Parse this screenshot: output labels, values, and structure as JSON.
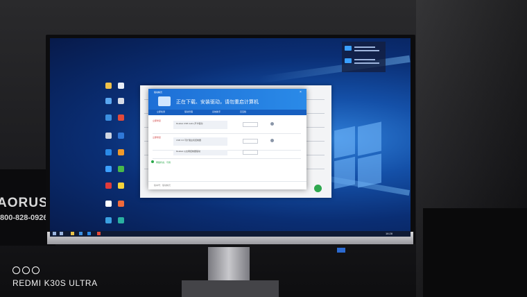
{
  "photo": {
    "watermark": "REDMI K30S ULTRA",
    "background_brand": "AORUS",
    "background_phone": "800-828-0926"
  },
  "desktop": {
    "wallpaper_color": "#1450a8",
    "installer": {
      "app_name": "驱动精灵",
      "title": "正在下载、安装驱动，请勿重启计算机",
      "tabs": [
        "立即检测",
        "驱动管理",
        "系统助手",
        "百宝箱"
      ],
      "rows": [
        {
          "label": "立即修复",
          "text": "Realtek USB Audio 声卡驱动"
        },
        {
          "label": "立即修复",
          "text": "USB 3.0 可扩展主机控制器"
        },
        {
          "label": "",
          "text": "Realtek 以太网控制器驱动"
        }
      ],
      "status": "网络状态：可用",
      "footer": "版本号：驱动精灵"
    },
    "taskbar": {
      "clock": "16:28"
    }
  },
  "colors": {
    "accent": "#1d6fd6",
    "status_green": "#2aa84a"
  }
}
